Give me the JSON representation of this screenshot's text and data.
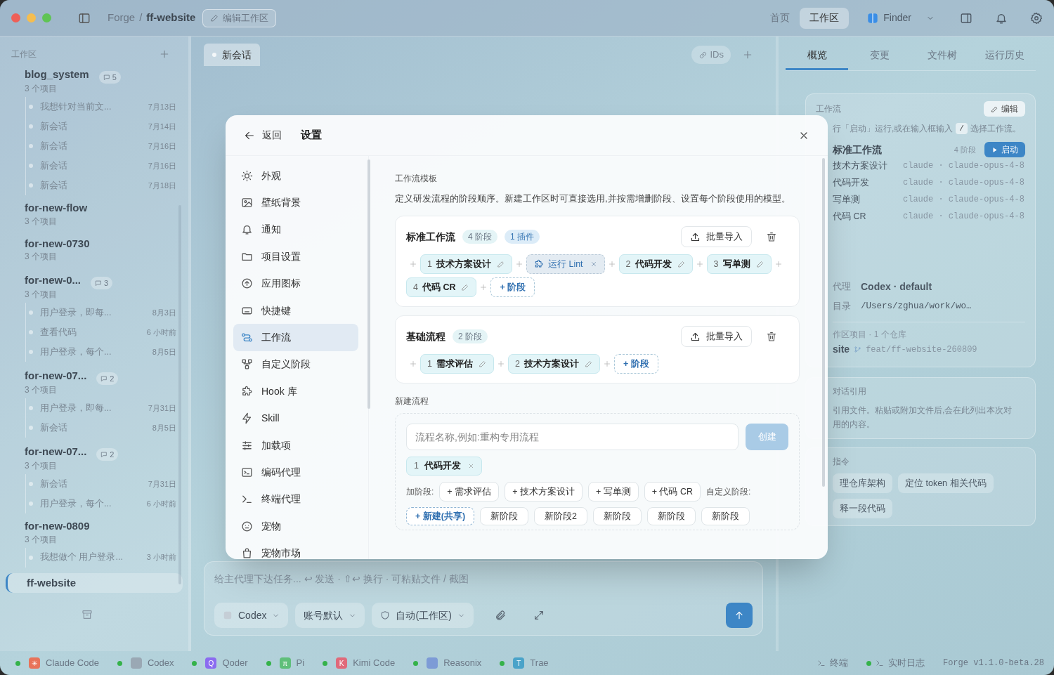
{
  "titlebar": {
    "app": "Forge",
    "separator": "/",
    "project": "ff-website",
    "edit_button": "编辑工作区",
    "nav": [
      {
        "label": "首页",
        "selected": false
      },
      {
        "label": "工作区",
        "selected": true
      }
    ],
    "finder": "Finder"
  },
  "sidebar": {
    "heading": "工作区",
    "workspaces": [
      {
        "name": "blog_system",
        "count": "3 个项目",
        "badge": "5",
        "selected": false,
        "sessions": [
          {
            "title": "我想针对当前文...",
            "time": "7月13日"
          },
          {
            "title": "新会话",
            "time": "7月14日"
          },
          {
            "title": "新会话",
            "time": "7月16日"
          },
          {
            "title": "新会话",
            "time": "7月16日"
          },
          {
            "title": "新会话",
            "time": "7月18日"
          }
        ]
      },
      {
        "name": "for-new-flow",
        "count": "3 个项目",
        "selected": false
      },
      {
        "name": "for-new-0730",
        "count": "3 个项目",
        "selected": false
      },
      {
        "name": "for-new-0...",
        "count": "3 个项目",
        "badge": "3",
        "selected": false,
        "sessions": [
          {
            "title": "用户登录，即每...",
            "time": "8月3日"
          },
          {
            "title": "查看代码",
            "time": "6 小时前"
          },
          {
            "title": "用户登录，每个...",
            "time": "8月5日"
          }
        ]
      },
      {
        "name": "for-new-07...",
        "count": "3 个项目",
        "badge": "2",
        "selected": false,
        "sessions": [
          {
            "title": "用户登录，即每...",
            "time": "7月31日"
          },
          {
            "title": "新会话",
            "time": "8月5日"
          }
        ]
      },
      {
        "name": "for-new-07...",
        "count": "3 个项目",
        "badge": "2",
        "selected": false,
        "sessions": [
          {
            "title": "新会话",
            "time": "7月31日"
          },
          {
            "title": "用户登录，每个...",
            "time": "6 小时前"
          }
        ]
      },
      {
        "name": "for-new-0809",
        "count": "3 个项目",
        "selected": false,
        "sessions": [
          {
            "title": "我想做个 用户登录...",
            "time": "3 小时前"
          }
        ]
      },
      {
        "name": "ff-website",
        "selected": true
      }
    ]
  },
  "center": {
    "tab": "新会话",
    "ids_button": "IDs",
    "composer": {
      "placeholder": "给主代理下达任务... ↩ 发送 · ⇧↩ 换行 · 可粘贴文件 / 截图",
      "agent": "Codex",
      "account": "账号默认",
      "mode": "自动(工作区)"
    }
  },
  "settings": {
    "back": "返回",
    "title": "设置",
    "nav": [
      {
        "label": "外观",
        "selected": false
      },
      {
        "label": "壁纸背景",
        "selected": false
      },
      {
        "label": "通知",
        "selected": false
      },
      {
        "label": "项目设置",
        "selected": false
      },
      {
        "label": "应用图标",
        "selected": false
      },
      {
        "label": "快捷键",
        "selected": false
      },
      {
        "label": "工作流",
        "selected": true
      },
      {
        "label": "自定义阶段",
        "selected": false
      },
      {
        "label": "Hook 库",
        "selected": false
      },
      {
        "label": "Skill",
        "selected": false
      },
      {
        "label": "加载项",
        "selected": false
      },
      {
        "label": "编码代理",
        "selected": false
      },
      {
        "label": "终端代理",
        "selected": false
      },
      {
        "label": "宠物",
        "selected": false
      },
      {
        "label": "宠物市场",
        "selected": false
      }
    ],
    "section_title": "工作流模板",
    "description": "定义研发流程的阶段顺序。新建工作区时可直接选用,并按需增删阶段、设置每个阶段使用的模型。",
    "templates": [
      {
        "name": "标准工作流",
        "stage_count": "4 阶段",
        "plugin_count": "1 插件",
        "import_button": "批量导入",
        "add_stage": "+ 阶段",
        "items": [
          {
            "kind": "stage",
            "num": "1",
            "label": "技术方案设计"
          },
          {
            "kind": "plugin",
            "label": "运行 Lint"
          },
          {
            "kind": "stage",
            "num": "2",
            "label": "代码开发"
          },
          {
            "kind": "stage",
            "num": "3",
            "label": "写单测"
          },
          {
            "kind": "stage",
            "num": "4",
            "label": "代码 CR"
          }
        ]
      },
      {
        "name": "基础流程",
        "stage_count": "2 阶段",
        "import_button": "批量导入",
        "add_stage": "+ 阶段",
        "items": [
          {
            "kind": "stage",
            "num": "1",
            "label": "需求评估"
          },
          {
            "kind": "stage",
            "num": "2",
            "label": "技术方案设计"
          }
        ]
      }
    ],
    "new_flow": {
      "title": "新建流程",
      "placeholder": "流程名称,例如:重构专用流程",
      "create_button": "创建",
      "selected_stages": [
        {
          "num": "1",
          "label": "代码开发"
        }
      ],
      "add_label": "加阶段:",
      "add_buttons": [
        "+ 需求评估",
        "+ 技术方案设计",
        "+ 写单测",
        "+ 代码 CR"
      ],
      "custom_label": "自定义阶段:",
      "new_shared": "+ 新建(共享)",
      "custom_stages": [
        "新阶段",
        "新阶段2",
        "新阶段",
        "新阶段",
        "新阶段"
      ]
    }
  },
  "right_panel": {
    "tabs": [
      {
        "label": "概览",
        "selected": true
      },
      {
        "label": "变更",
        "selected": false
      },
      {
        "label": "文件树",
        "selected": false
      },
      {
        "label": "运行历史",
        "selected": false
      }
    ],
    "workflow": {
      "label": "工作流",
      "edit_button": "编辑",
      "hint_before": "行「启动」运行,或在输入框输入",
      "hint_key": "/",
      "hint_after": "选择工作流。",
      "name": "标准工作流",
      "stage_count": "4 阶段",
      "start_button": "启动",
      "stages": [
        {
          "name": "技术方案设计",
          "model": "claude · claude-opus-4-8"
        },
        {
          "name": "代码开发",
          "model": "claude · claude-opus-4-8"
        },
        {
          "name": "写单测",
          "model": "claude · claude-opus-4-8"
        },
        {
          "name": "代码 CR",
          "model": "claude · claude-opus-4-8"
        }
      ],
      "info": [
        {
          "label": "代理",
          "value": "Codex · default",
          "kind": "text"
        },
        {
          "label": "目录",
          "value": "/Users/zghua/work/wo…",
          "kind": "path"
        }
      ],
      "projects_label": "作区项目 · 1 个仓库",
      "project": "site",
      "branch": "feat/ff-website-260809"
    },
    "references": {
      "label": "对话引用",
      "text": "引用文件。粘贴或附加文件后,会在此列出本次对用的内容。"
    },
    "commands": {
      "label": "指令",
      "items": [
        "理仓库架构",
        "定位 token 相关代码",
        "释一段代码"
      ]
    }
  },
  "status_bar": {
    "agents": [
      {
        "name": "Claude Code",
        "color": "#e8735a",
        "letter": "✳"
      },
      {
        "name": "Codex",
        "color": "#9aa8b4"
      },
      {
        "name": "Qoder",
        "color": "#8b6cf0",
        "letter": "Q"
      },
      {
        "name": "Pi",
        "color": "#5fbf7a",
        "letter": "π"
      },
      {
        "name": "Kimi Code",
        "color": "#e06a7a",
        "letter": "K"
      },
      {
        "name": "Reasonix",
        "color": "#7d9bd6"
      },
      {
        "name": "Trae",
        "color": "#4aa3c9",
        "letter": "T"
      }
    ],
    "terminal": "终端",
    "logs": "实时日志",
    "version": "Forge v1.1.0-beta.28"
  }
}
